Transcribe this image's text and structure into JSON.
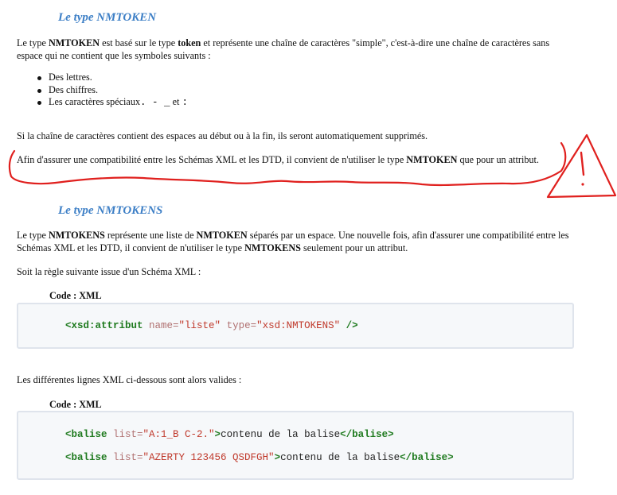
{
  "section1": {
    "heading": "Le type NMTOKEN",
    "intro": {
      "t1": "Le type ",
      "b1": "NMTOKEN",
      "t2": " est basé sur le type ",
      "b2": "token",
      "t3": " et représente une chaîne de caractères \"simple\", c'est-à-dire une chaîne de caractères sans espace qui ne contient que les symboles suivants :"
    },
    "list": [
      "Des lettres.",
      "Des chiffres."
    ],
    "special": {
      "label": "Les caractères spéciaux",
      "chars": ". - _",
      "and": " et ",
      "colon": ":"
    },
    "trim_note": "Si la chaîne de caractères contient des espaces au début ou à la fin, ils seront automatiquement supprimés.",
    "compat": {
      "t1": "Afin d'assurer une compatibilité entre les Schémas XML et les DTD, il convient de n'utiliser le type ",
      "b1": "NMTOKEN",
      "t2": " que pour un attribut."
    }
  },
  "section2": {
    "heading": "Le type NMTOKENS",
    "intro": {
      "t1": "Le type ",
      "b1": "NMTOKENS",
      "t2": " représente une liste de ",
      "b2": "NMTOKEN",
      "t3": " séparés par un espace. Une nouvelle fois, afin d'assurer une compatibilité entre les Schémas XML et les DTD, il convient de n'utiliser le type ",
      "b3": "NMTOKENS",
      "t4": " seulement pour un attribut."
    },
    "rule_intro": "Soit la règle suivante issue d'un Schéma XML :",
    "code1": {
      "label": "Code : XML",
      "open": "<xsd:attribut",
      "a1": " name=",
      "v1": "\"liste\"",
      "a2": " type=",
      "v2": "\"xsd:NMTOKENS\"",
      "close": " />"
    },
    "valid_intro": "Les différentes lignes XML ci-dessous sont alors valides :",
    "code2": {
      "label": "Code : XML",
      "lines": [
        {
          "open": "<balise",
          "attr": " list=",
          "val": "\"A:1_B C-2.\"",
          "gt": ">",
          "text": "contenu de la balise",
          "close": "</balise>"
        },
        {
          "open": "<balise",
          "attr": " list=",
          "val": "\"AZERTY 123456 QSDFGH\"",
          "gt": ">",
          "text": "contenu de la balise",
          "close": "</balise>"
        }
      ]
    }
  },
  "colors": {
    "heading": "#3d7fc6",
    "annotation": "#e0201e",
    "tag": "#1e7a1e",
    "attr_value": "#c0392b"
  }
}
